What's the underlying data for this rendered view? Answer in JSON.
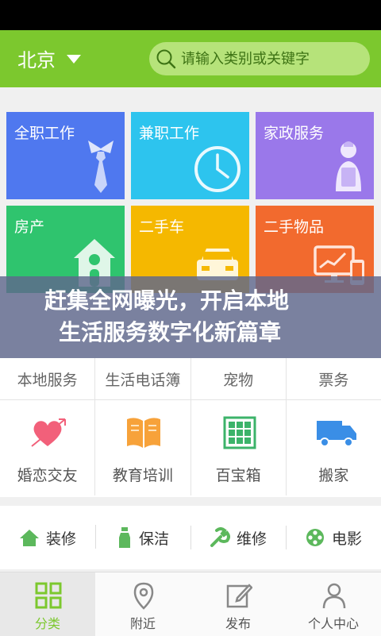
{
  "header": {
    "city": "北京",
    "search_placeholder": "请输入类别或关键字"
  },
  "tiles": [
    {
      "label": "全职工作",
      "color": "#4f78ef",
      "icon": "necktie-icon"
    },
    {
      "label": "兼职工作",
      "color": "#2dc4ee",
      "icon": "clock-icon"
    },
    {
      "label": "家政服务",
      "color": "#9a78ea",
      "icon": "housekeeper-icon"
    },
    {
      "label": "房产",
      "color": "#2fc46e",
      "icon": "house-icon"
    },
    {
      "label": "二手车",
      "color": "#f5b800",
      "icon": "car-icon"
    },
    {
      "label": "二手物品",
      "color": "#f26a2e",
      "icon": "monitor-phone-icon"
    }
  ],
  "overlay": {
    "line1": "赶集全网曝光，开启本地",
    "line2": "生活服务数字化新篇章"
  },
  "categories_row1": [
    "本地服务",
    "生活电话簿",
    "宠物",
    "票务"
  ],
  "categories_row2": [
    {
      "label": "婚恋交友",
      "icon": "heart-arrow-icon"
    },
    {
      "label": "教育培训",
      "icon": "book-icon"
    },
    {
      "label": "百宝箱",
      "icon": "treasure-box-icon"
    },
    {
      "label": "搬家",
      "icon": "truck-icon"
    }
  ],
  "services": [
    {
      "label": "装修",
      "icon": "home-icon"
    },
    {
      "label": "保洁",
      "icon": "spray-bottle-icon"
    },
    {
      "label": "维修",
      "icon": "wrench-icon"
    },
    {
      "label": "电影",
      "icon": "film-reel-icon"
    }
  ],
  "tabbar": [
    {
      "label": "分类",
      "icon": "grid-icon",
      "active": true
    },
    {
      "label": "附近",
      "icon": "location-pin-icon"
    },
    {
      "label": "发布",
      "icon": "edit-icon"
    },
    {
      "label": "个人中心",
      "icon": "person-icon"
    }
  ],
  "colors": {
    "brand_green": "#7cc82e",
    "search_bg": "#b6e37a"
  }
}
